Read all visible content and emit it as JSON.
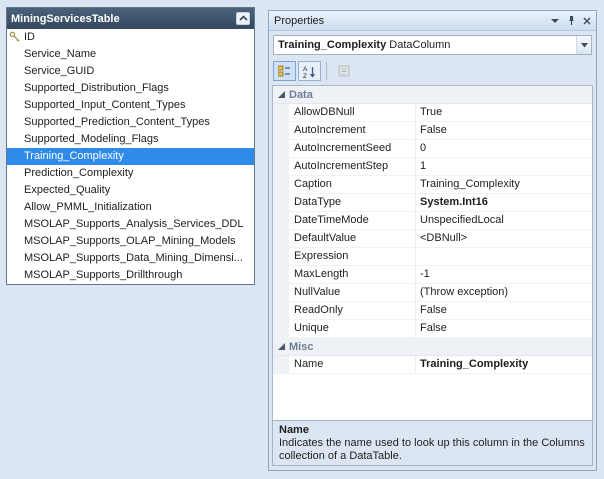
{
  "table": {
    "title": "MiningServicesTable",
    "selected": "Training_Complexity",
    "key_column": "ID",
    "columns": [
      "ID",
      "Service_Name",
      "Service_GUID",
      "Supported_Distribution_Flags",
      "Supported_Input_Content_Types",
      "Supported_Prediction_Content_Types",
      "Supported_Modeling_Flags",
      "Training_Complexity",
      "Prediction_Complexity",
      "Expected_Quality",
      "Allow_PMML_Initialization",
      "MSOLAP_Supports_Analysis_Services_DDL",
      "MSOLAP_Supports_OLAP_Mining_Models",
      "MSOLAP_Supports_Data_Mining_Dimensi...",
      "MSOLAP_Supports_Drillthrough"
    ]
  },
  "properties": {
    "title": "Properties",
    "object_name": "Training_Complexity",
    "object_type": "DataColumn",
    "icons": {
      "titlebar": [
        "window-menu-icon",
        "pin-icon",
        "close-icon"
      ],
      "toolbar": [
        "categorized-icon",
        "az-sort-icon",
        "property-pages-icon"
      ],
      "table_header": "collapse-chevron-icon",
      "key_row": "primary-key-icon"
    },
    "groups": [
      {
        "label": "Data",
        "rows": [
          {
            "name": "AllowDBNull",
            "value": "True",
            "bold": false
          },
          {
            "name": "AutoIncrement",
            "value": "False",
            "bold": false
          },
          {
            "name": "AutoIncrementSeed",
            "value": "0",
            "bold": false
          },
          {
            "name": "AutoIncrementStep",
            "value": "1",
            "bold": false
          },
          {
            "name": "Caption",
            "value": "Training_Complexity",
            "bold": false
          },
          {
            "name": "DataType",
            "value": "System.Int16",
            "bold": true
          },
          {
            "name": "DateTimeMode",
            "value": "UnspecifiedLocal",
            "bold": false
          },
          {
            "name": "DefaultValue",
            "value": "<DBNull>",
            "bold": false
          },
          {
            "name": "Expression",
            "value": "",
            "bold": false
          },
          {
            "name": "MaxLength",
            "value": "-1",
            "bold": false
          },
          {
            "name": "NullValue",
            "value": "(Throw exception)",
            "bold": false
          },
          {
            "name": "ReadOnly",
            "value": "False",
            "bold": false
          },
          {
            "name": "Unique",
            "value": "False",
            "bold": false
          }
        ]
      },
      {
        "label": "Misc",
        "rows": [
          {
            "name": "Name",
            "value": "Training_Complexity",
            "bold": true
          }
        ]
      }
    ],
    "help": {
      "title": "Name",
      "description": "Indicates the name used to look up this column in the Columns collection of a DataTable."
    }
  },
  "colors": {
    "background": "#dce6f3",
    "table_header": "#3c536b",
    "selection": "#2f8bea",
    "category_text": "#6e7d96"
  }
}
